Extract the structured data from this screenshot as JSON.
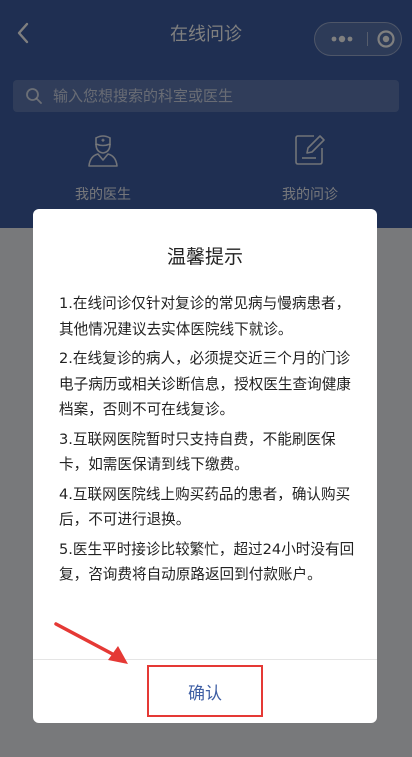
{
  "navbar": {
    "title": "在线问诊",
    "back_icon": "chevron-left-icon",
    "more_icon": "more-dots-icon",
    "close_icon": "target-circle-icon"
  },
  "search": {
    "placeholder": "输入您想搜索的科室或医生",
    "icon": "search-icon"
  },
  "quick_links": [
    {
      "label": "我的医生",
      "icon": "doctor-icon"
    },
    {
      "label": "我的问诊",
      "icon": "edit-note-icon"
    }
  ],
  "dialog": {
    "title": "温馨提示",
    "items": [
      "1.在线问诊仅针对复诊的常见病与慢病患者，其他情况建议去实体医院线下就诊。",
      "2.在线复诊的病人，必须提交近三个月的门诊电子病历或相关诊断信息，授权医生查询健康档案，否则不可在线复诊。",
      "3.互联网医院暂时只支持自费，不能刷医保卡，如需医保请到线下缴费。",
      "4.互联网医院线上购买药品的患者，确认购买后，不可进行退换。",
      "5.医生平时接诊比较繁忙，超过24小时没有回复，咨询费将自动原路返回到付款账户。"
    ],
    "confirm_label": "确认"
  },
  "colors": {
    "header_bg": "#3f5fa4",
    "highlight": "#e53935",
    "confirm_text": "#3f5fa4"
  }
}
